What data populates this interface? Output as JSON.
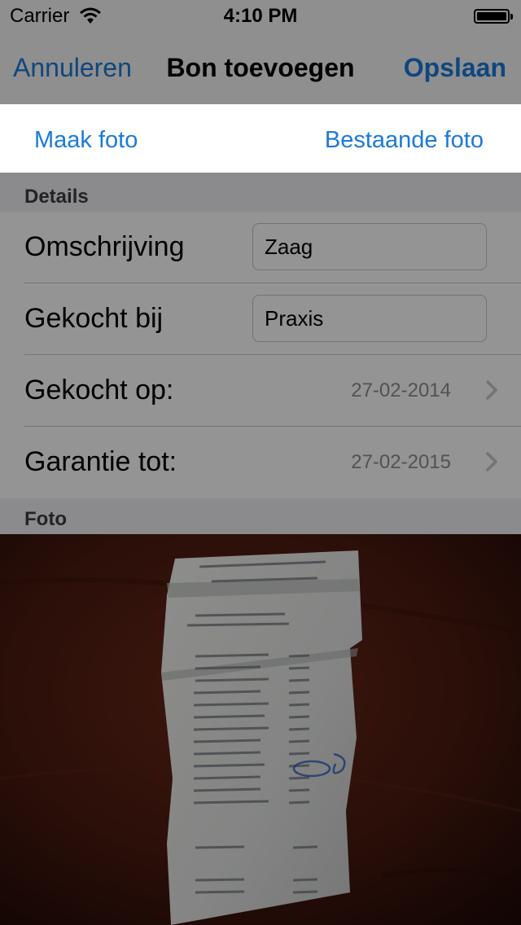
{
  "status_bar": {
    "carrier": "Carrier",
    "time": "4:10 PM"
  },
  "nav": {
    "cancel_label": "Annuleren",
    "title": "Bon toevoegen",
    "save_label": "Opslaan"
  },
  "photo_choice": {
    "take_photo": "Maak foto",
    "existing_photo": "Bestaande foto"
  },
  "details": {
    "header": "Details",
    "description": {
      "label": "Omschrijving",
      "value": "Zaag"
    },
    "store": {
      "label": "Gekocht bij",
      "value": "Praxis"
    },
    "purchase_date": {
      "label": "Gekocht op:",
      "value": "27-02-2014"
    },
    "warranty_until": {
      "label": "Garantie tot:",
      "value": "27-02-2015"
    }
  },
  "photo": {
    "header": "Foto"
  },
  "colors": {
    "accent": "#1a7ad8",
    "overlay": "rgba(0,0,0,0.42)"
  }
}
